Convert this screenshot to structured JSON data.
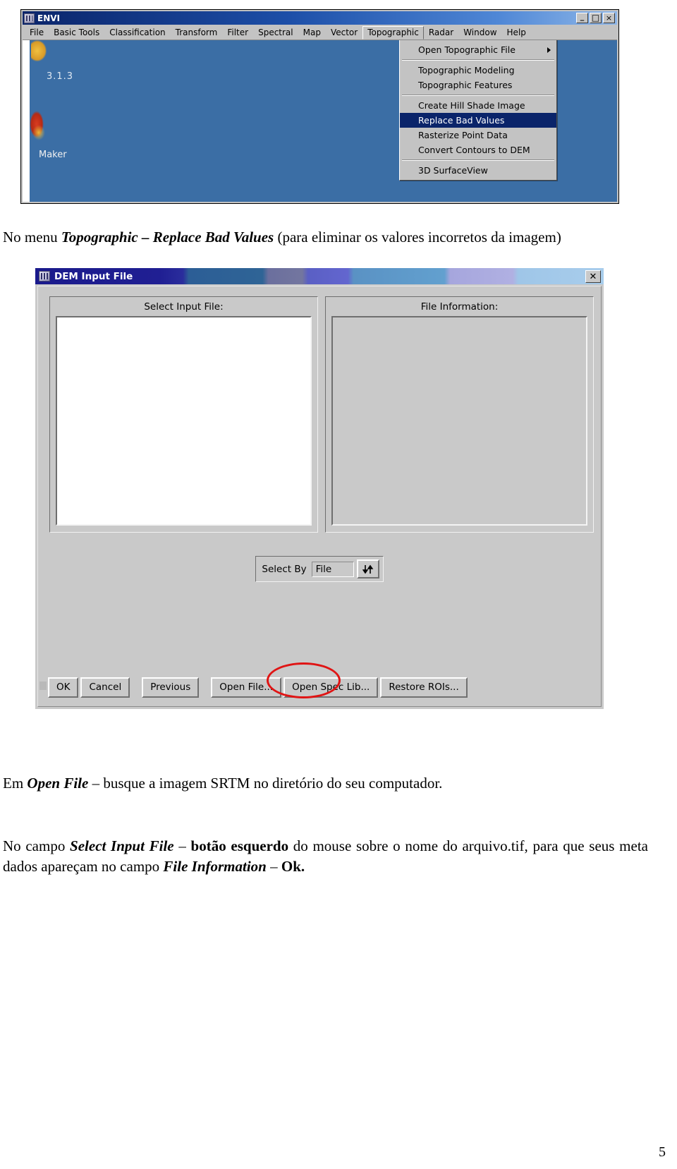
{
  "envi_window": {
    "title": "ENVI",
    "title_icon": "envi-app-icon",
    "window_buttons": [
      {
        "name": "minimize",
        "glyph": "_"
      },
      {
        "name": "maximize",
        "glyph": "□"
      },
      {
        "name": "close",
        "glyph": "×"
      }
    ],
    "menubar": [
      {
        "label": "File",
        "active": false
      },
      {
        "label": "Basic Tools",
        "active": false
      },
      {
        "label": "Classification",
        "active": false
      },
      {
        "label": "Transform",
        "active": false
      },
      {
        "label": "Filter",
        "active": false
      },
      {
        "label": "Spectral",
        "active": false
      },
      {
        "label": "Map",
        "active": false
      },
      {
        "label": "Vector",
        "active": false
      },
      {
        "label": "Topographic",
        "active": true
      },
      {
        "label": "Radar",
        "active": false
      },
      {
        "label": "Window",
        "active": false
      },
      {
        "label": "Help",
        "active": false
      }
    ],
    "desktop": {
      "version": "3.1.3",
      "maker_label": "Maker",
      "background_color": "#3b6ea5"
    },
    "dropdown": {
      "items": [
        {
          "label": "Open Topographic File",
          "submenu": true,
          "selected": false
        },
        {
          "separator": true
        },
        {
          "label": "Topographic Modeling",
          "submenu": false,
          "selected": false
        },
        {
          "label": "Topographic Features",
          "submenu": false,
          "selected": false
        },
        {
          "separator": true
        },
        {
          "label": "Create Hill Shade Image",
          "submenu": false,
          "selected": false
        },
        {
          "label": "Replace Bad Values",
          "submenu": false,
          "selected": true
        },
        {
          "label": "Rasterize Point Data",
          "submenu": false,
          "selected": false
        },
        {
          "label": "Convert Contours to DEM",
          "submenu": false,
          "selected": false
        },
        {
          "separator": true
        },
        {
          "label": "3D SurfaceView",
          "submenu": false,
          "selected": false
        }
      ],
      "highlight_color": "#0a246a"
    }
  },
  "captions": {
    "caption_1": {
      "p1_plain_a": "No menu ",
      "p1_bold_italic": "Topographic – Replace Bad Values",
      "p1_plain_b": " (para eliminar os valores incorretos da imagem)"
    },
    "caption_2": {
      "p2_plain_a": "Em ",
      "p2_bold_italic": "Open File",
      "p2_plain_b": " – busque a imagem SRTM no diretório do seu computador."
    },
    "caption_3": {
      "p3_plain_a": "No campo ",
      "p3_bold_italic_a": "Select Input File",
      "p3_plain_b": " – ",
      "p3_bold_a": "botão esquerdo",
      "p3_plain_c": " do mouse sobre o nome do arquivo.tif, para que seus meta dados apareçam no campo ",
      "p3_bold_italic_b": "File Information",
      "p3_plain_d": " – ",
      "p3_bold_b": "Ok."
    }
  },
  "dem_dialog": {
    "title": "DEM Input File",
    "title_icon": "dialog-app-icon",
    "close_glyph": "✕",
    "left_panel": {
      "label": "Select Input File:",
      "list_items": []
    },
    "right_panel": {
      "label": "File Information:",
      "content": ""
    },
    "select_by": {
      "label": "Select By",
      "value": "File",
      "toggle_icon": "up-down-arrows-icon"
    },
    "buttons": [
      {
        "label": "OK",
        "highlighted": false
      },
      {
        "label": "Cancel",
        "highlighted": false
      },
      {
        "label": "Previous",
        "highlighted": false
      },
      {
        "label": "Open File...",
        "highlighted": true
      },
      {
        "label": "Open Spec Lib...",
        "highlighted": false
      },
      {
        "label": "Restore ROIs...",
        "highlighted": false
      }
    ],
    "annotation": {
      "shape": "ellipse",
      "color": "#e01414",
      "targets": "Open File..."
    }
  },
  "page": {
    "number": "5"
  }
}
